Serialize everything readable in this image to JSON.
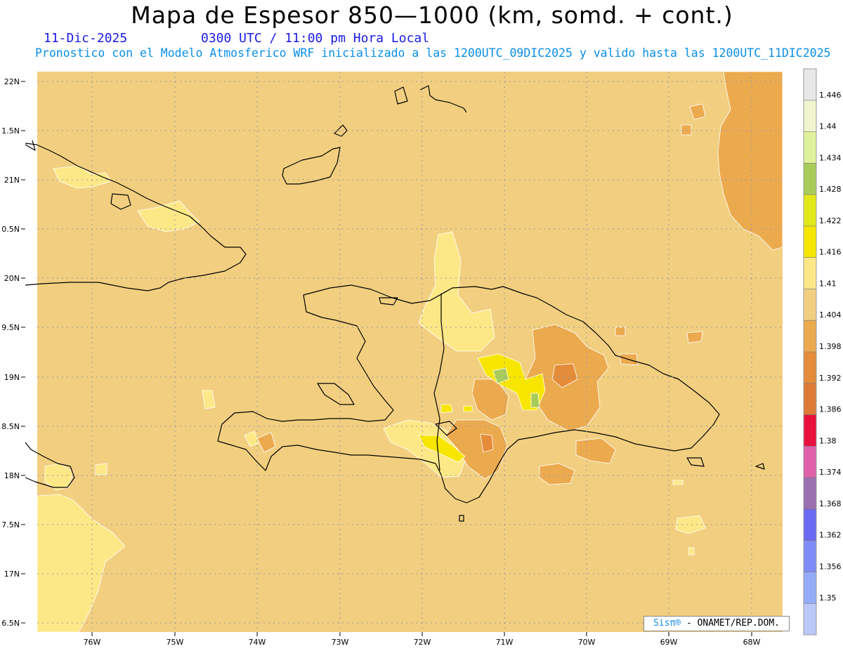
{
  "header": {
    "title": "Mapa de Espesor 850—1000 (km, somd. + cont.)",
    "date": "11-Dic-2025",
    "time": "0300 UTC / 11:00 pm Hora Local",
    "forecast": "Pronostico con el Modelo Atmosferico WRF inicializado a las 1200UTC_09DIC2025 y valido hasta las  1200UTC_11DIC2025"
  },
  "axes": {
    "lat_labels": [
      "22N",
      "1.5N",
      "21N",
      "0.5N",
      "20N",
      "9.5N",
      "19N",
      "8.5N",
      "18N",
      "7.5N",
      "17N",
      "6.5N"
    ],
    "lon_labels": [
      "76W",
      "75W",
      "74W",
      "73W",
      "72W",
      "71W",
      "70W",
      "69W",
      "68W"
    ]
  },
  "colorbar": {
    "labels": [
      "1.446",
      "1.44",
      "1.434",
      "1.428",
      "1.422",
      "1.416",
      "1.41",
      "1.404",
      "1.398",
      "1.392",
      "1.386",
      "1.38",
      "1.374",
      "1.368",
      "1.362",
      "1.356",
      "1.35"
    ],
    "colors": [
      "#e8e8e8",
      "#f0f5d0",
      "#dff09a",
      "#a8cc5a",
      "#e2e81a",
      "#f7e600",
      "#fde887",
      "#f2cf80",
      "#ecaa4f",
      "#e48c3a",
      "#dd7a36",
      "#e8103c",
      "#e060aa",
      "#9a70b0",
      "#6a6af2",
      "#7f8cf7",
      "#94acf8",
      "#b9c8f8"
    ]
  },
  "colors": {
    "base_field": "#f2cf80",
    "light_field": "#fde887",
    "orange_field": "#ecaa4f",
    "dark_orange_field": "#e48c3a",
    "yellow_field": "#f7e600",
    "green_field": "#a8cc5a"
  },
  "credit": {
    "logo": "Sisπ®",
    "text": " - ONAMET/REP.DOM."
  }
}
